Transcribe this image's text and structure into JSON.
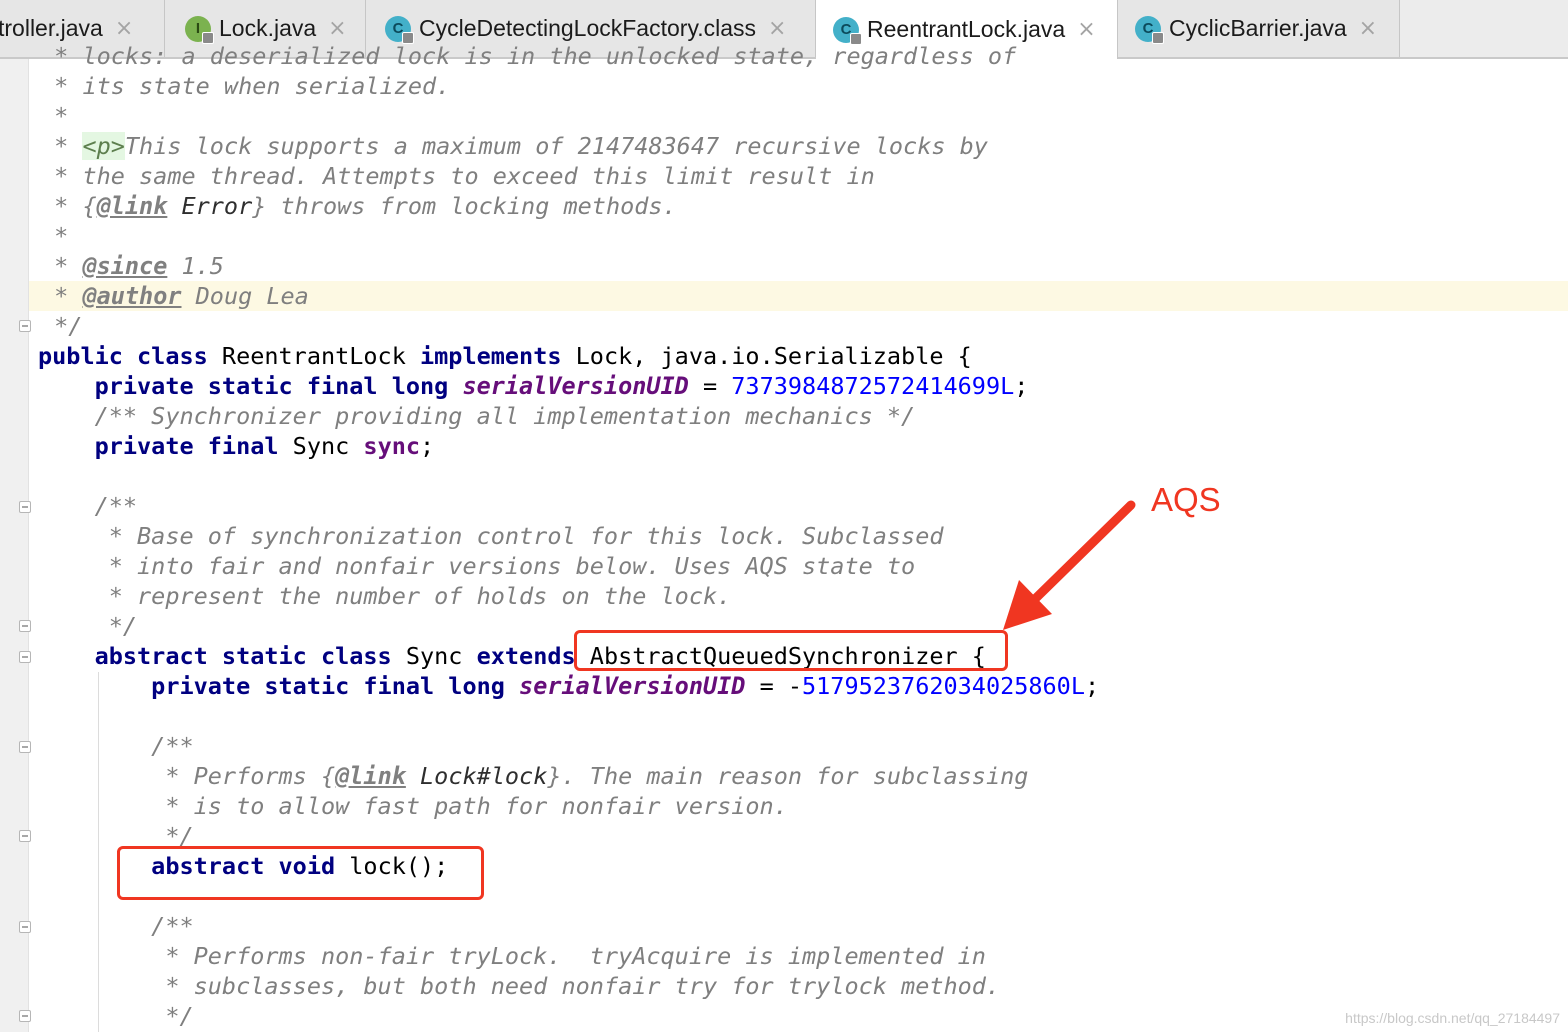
{
  "tabs": [
    {
      "label": "troller.java",
      "icon": "none",
      "active": false
    },
    {
      "label": "Lock.java",
      "icon": "interface-icon",
      "icon_letter": "I",
      "active": false
    },
    {
      "label": "CycleDetectingLockFactory.class",
      "icon": "class-icon",
      "icon_letter": "C",
      "active": false
    },
    {
      "label": "ReentrantLock.java",
      "icon": "class-icon",
      "icon_letter": "C",
      "active": true
    },
    {
      "label": "CyclicBarrier.java",
      "icon": "class-icon",
      "icon_letter": "C",
      "active": false
    }
  ],
  "tab_close_glyph": "×",
  "code": {
    "l0": {
      "a": " * locks: a deserialized lock is in the unlocked state, regardless of"
    },
    "l1": {
      "a": " * its state when serialized."
    },
    "l2": {
      "a": " *"
    },
    "l3": {
      "a": " * ",
      "b": "<p>",
      "c": "This lock supports a maximum of 2147483647 recursive locks by"
    },
    "l4": {
      "a": " * the same thread. Attempts to exceed this limit result in"
    },
    "l5": {
      "a": " * {",
      "b": "@link",
      "c": " Error",
      "d": "} throws from locking methods."
    },
    "l6": {
      "a": " *"
    },
    "l7": {
      "a": " * ",
      "b": "@since",
      "c": " 1.5"
    },
    "l8": {
      "a": " * ",
      "b": "@author",
      "c": " Doug Lea"
    },
    "l9": {
      "a": " */"
    },
    "l10": {
      "a": "public class",
      "b": " ReentrantLock ",
      "c": "implements",
      "d": " Lock, java.io.Serializable {"
    },
    "l11": {
      "a": "    private static final long ",
      "b": "serialVersionUID",
      "c": " = ",
      "d": "7373984872572414699L",
      "e": ";"
    },
    "l12": {
      "a": "    /** Synchronizer providing all implementation mechanics */"
    },
    "l13": {
      "a": "    private final",
      "b": " Sync ",
      "c": "sync",
      "d": ";"
    },
    "l15": {
      "a": "    /**"
    },
    "l16": {
      "a": "     * Base of synchronization control for this lock. Subclassed"
    },
    "l17": {
      "a": "     * into fair and nonfair versions below. Uses AQS state to"
    },
    "l18": {
      "a": "     * represent the number of holds on the lock."
    },
    "l19": {
      "a": "     */"
    },
    "l20": {
      "a": "    abstract static class",
      "b": " Sync ",
      "c": "extends",
      "d": " AbstractQueuedSynchronizer {"
    },
    "l21": {
      "a": "        private static final long ",
      "b": "serialVersionUID",
      "c": " = -",
      "d": "5179523762034025860L",
      "e": ";"
    },
    "l23": {
      "a": "        /**"
    },
    "l24": {
      "a": "         * Performs {",
      "b": "@link",
      "c": " Lock#lock",
      "d": "}. The main reason for subclassing"
    },
    "l25": {
      "a": "         * is to allow fast path for nonfair version."
    },
    "l26": {
      "a": "         */"
    },
    "l27": {
      "a": "        abstract void",
      "b": " lock();"
    },
    "l29": {
      "a": "        /**"
    },
    "l30": {
      "a": "         * Performs non-fair tryLock.  tryAcquire is implemented in"
    },
    "l31": {
      "a": "         * subclasses, but both need nonfair try for trylock method."
    },
    "l32": {
      "a": "         */"
    }
  },
  "annotation": {
    "label": "AQS",
    "color": "#f03621"
  },
  "watermark": "https://blog.csdn.net/qq_27184497"
}
